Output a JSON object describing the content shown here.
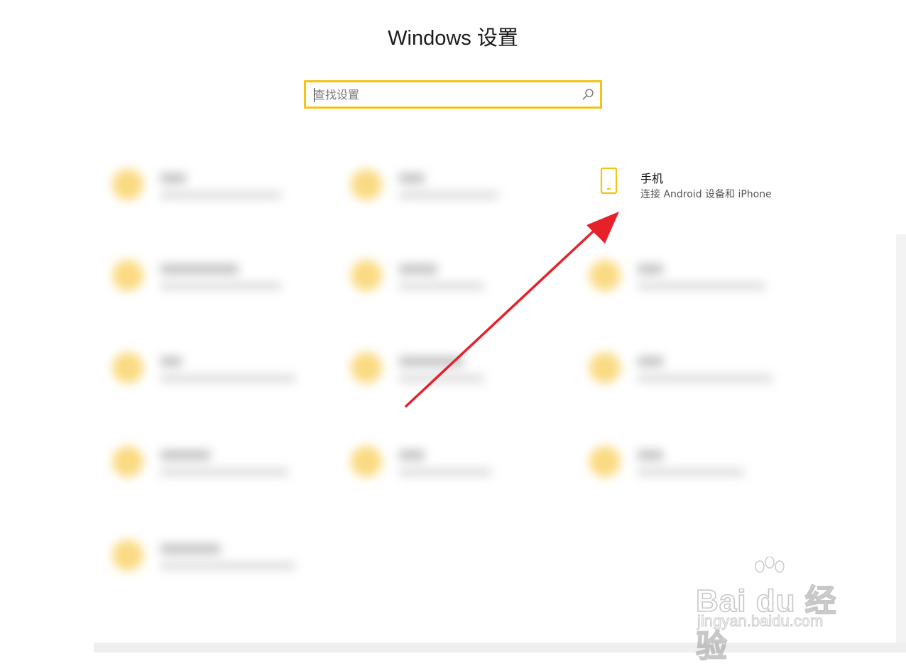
{
  "window": {
    "title": "Windows 设置"
  },
  "search": {
    "placeholder": "查找设置",
    "value": ""
  },
  "tiles": {
    "phone": {
      "title": "手机",
      "subtitle": "连接 Android 设备和 iPhone"
    }
  },
  "colors": {
    "accent": "#f3c312",
    "arrow": "#e5222a"
  },
  "watermark": {
    "brand": "Bai du 经验",
    "url": "jingyan.baidu.com"
  }
}
